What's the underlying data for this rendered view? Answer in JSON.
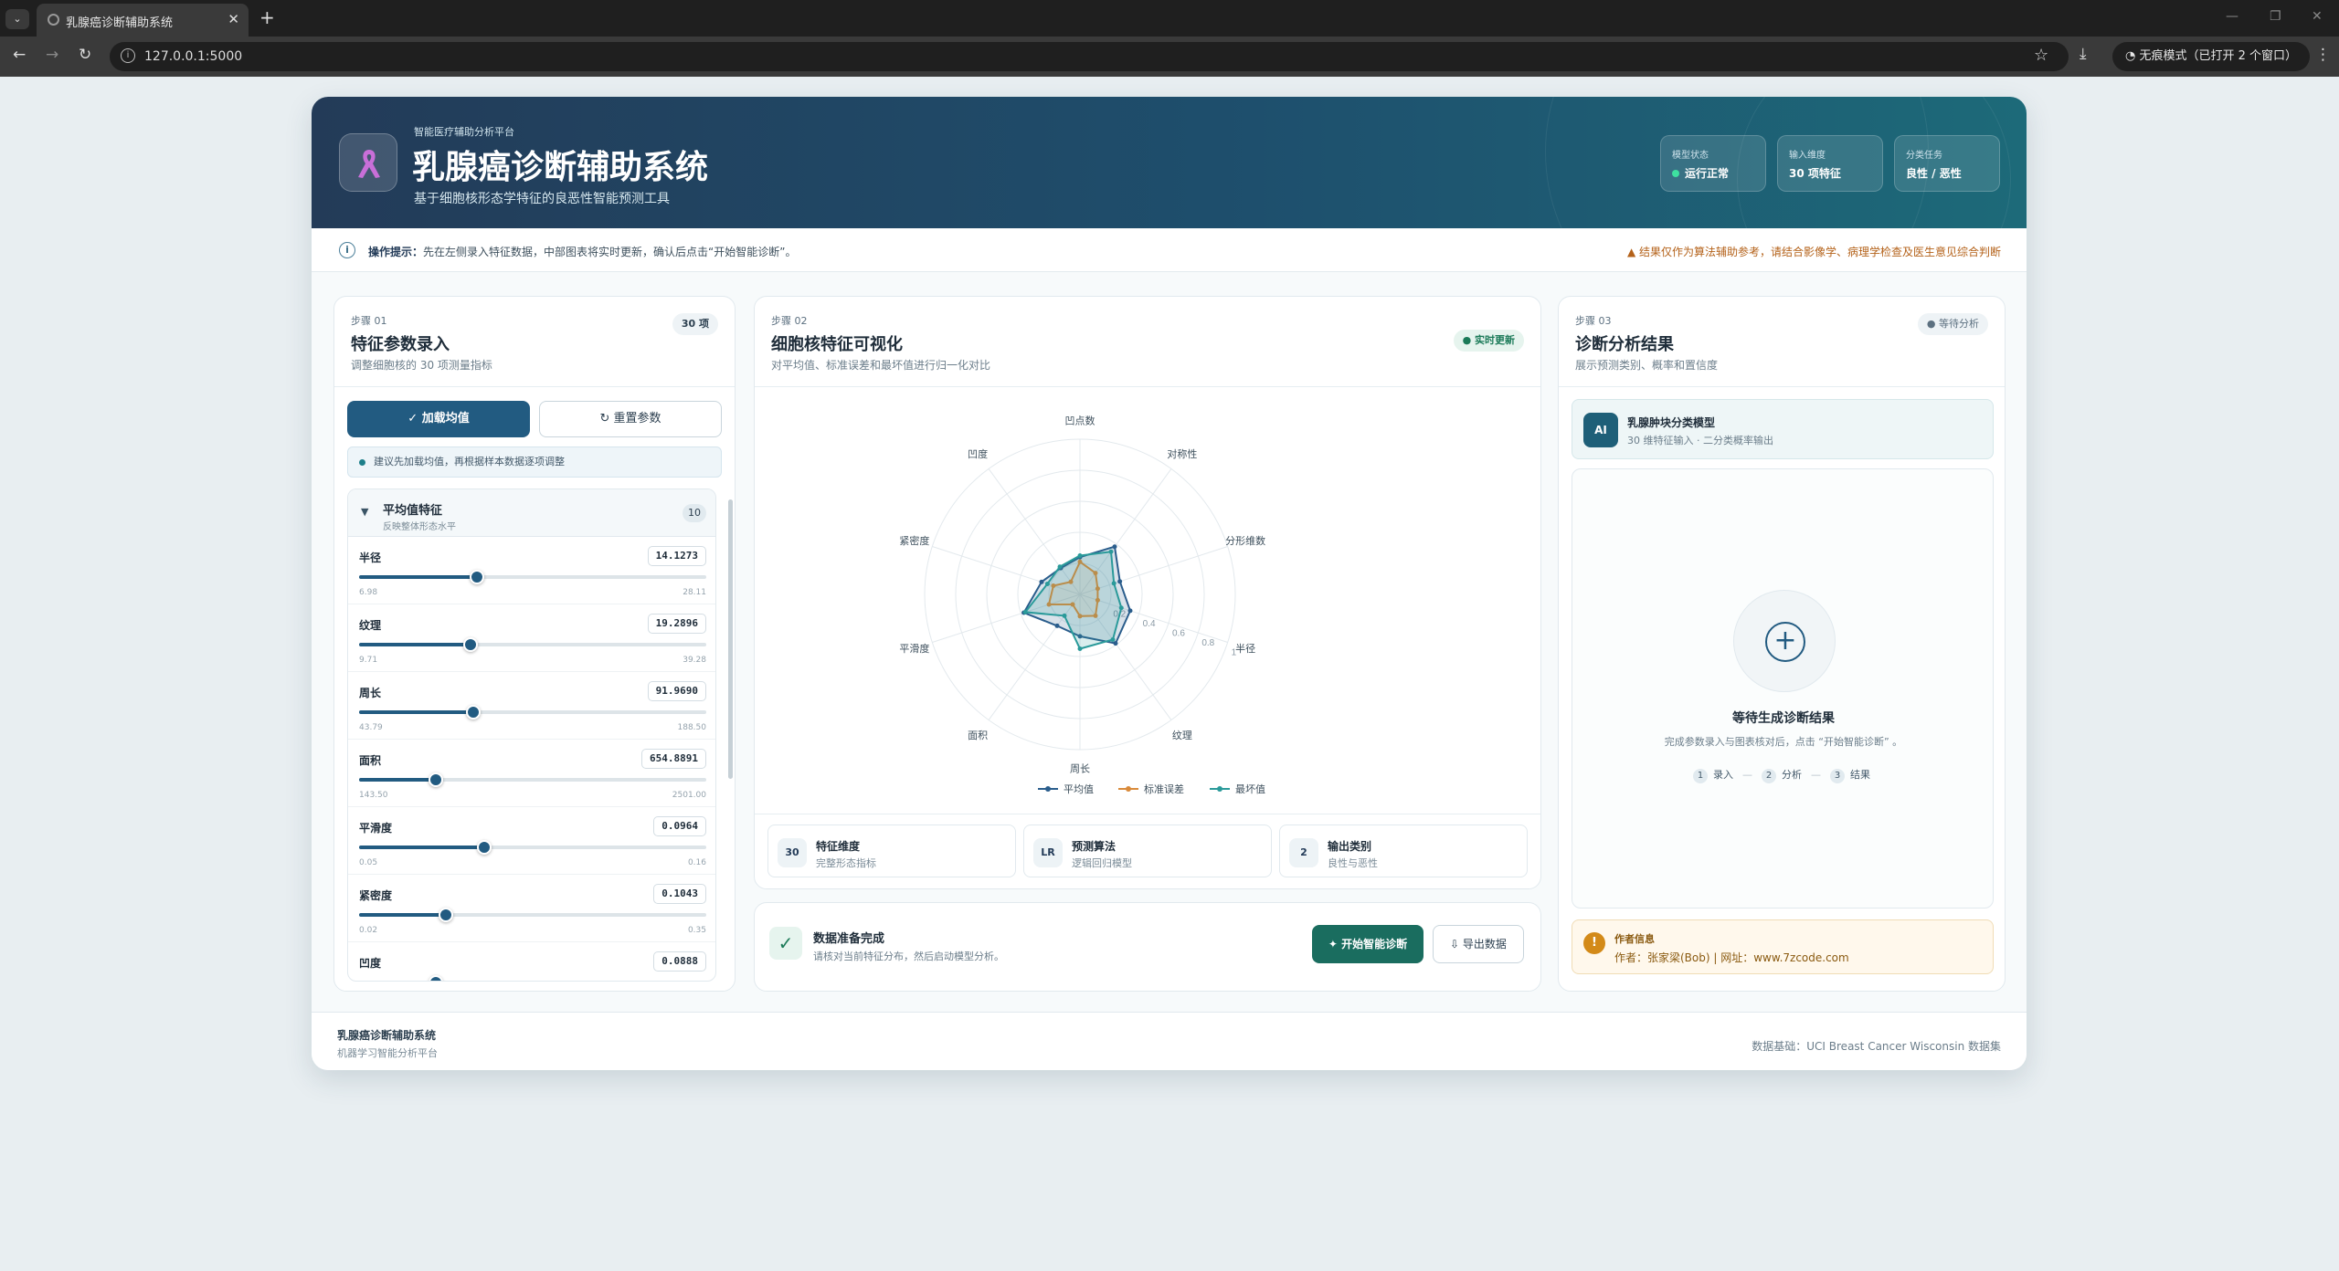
{
  "browser": {
    "tab_title": "乳腺癌诊断辅助系统",
    "url": "127.0.0.1:5000",
    "incognito_label": "无痕模式（已打开 2 个窗口）"
  },
  "header": {
    "kicker": "智能医疗辅助分析平台",
    "title": "乳腺癌诊断辅助系统",
    "subtitle": "基于细胞核形态学特征的良恶性智能预测工具",
    "stats": [
      {
        "label": "模型状态",
        "value": "运行正常"
      },
      {
        "label": "输入维度",
        "value": "30 项特征"
      },
      {
        "label": "分类任务",
        "value": "良性 / 恶性"
      }
    ]
  },
  "tips": {
    "prefix": "操作提示：",
    "text": "先在左侧录入特征数据，中部图表将实时更新，确认后点击“开始智能诊断”。",
    "warning": "结果仅作为算法辅助参考，请结合影像学、病理学检查及医生意见综合判断"
  },
  "left_panel": {
    "step": "步骤 01",
    "title": "特征参数录入",
    "subtitle": "调整细胞核的 30 项测量指标",
    "badge": "30 项",
    "load_button": "加载均值",
    "reset_button": "重置参数",
    "hint": "建议先加载均值，再根据样本数据逐项调整",
    "group": {
      "name": "平均值特征",
      "subtitle": "反映整体形态水平",
      "count": "10"
    },
    "features": [
      {
        "label": "半径",
        "value": "14.1273",
        "min": "6.98",
        "max": "28.11",
        "fraction": 0.34
      },
      {
        "label": "纹理",
        "value": "19.2896",
        "min": "9.71",
        "max": "39.28",
        "fraction": 0.32
      },
      {
        "label": "周长",
        "value": "91.9690",
        "min": "43.79",
        "max": "188.50",
        "fraction": 0.33
      },
      {
        "label": "面积",
        "value": "654.8891",
        "min": "143.50",
        "max": "2501.00",
        "fraction": 0.22
      },
      {
        "label": "平滑度",
        "value": "0.0964",
        "min": "0.05",
        "max": "0.16",
        "fraction": 0.36
      },
      {
        "label": "紧密度",
        "value": "0.1043",
        "min": "0.02",
        "max": "0.35",
        "fraction": 0.25
      },
      {
        "label": "凹度",
        "value": "0.0888",
        "min": "",
        "max": "",
        "fraction": 0.22
      }
    ]
  },
  "middle_panel": {
    "step": "步骤 02",
    "title": "细胞核特征可视化",
    "subtitle": "对平均值、标准误差和最坏值进行归一化对比",
    "badge": "实时更新",
    "stats": [
      {
        "icon": "30",
        "title": "特征维度",
        "desc": "完整形态指标"
      },
      {
        "icon": "LR",
        "title": "预测算法",
        "desc": "逻辑回归模型"
      },
      {
        "icon": "2",
        "title": "输出类别",
        "desc": "良性与恶性"
      }
    ],
    "action": {
      "title": "数据准备完成",
      "desc": "请核对当前特征分布，然后启动模型分析。",
      "start_button": "开始智能诊断",
      "export_button": "导出数据"
    }
  },
  "chart_data": {
    "type": "radar",
    "axes": [
      "半径",
      "纹理",
      "周长",
      "面积",
      "平滑度",
      "紧密度",
      "凹度",
      "凹点数",
      "对称性",
      "分形维数"
    ],
    "rlim": [
      0,
      1
    ],
    "ticks": [
      "0.2",
      "0.4",
      "0.6",
      "0.8",
      "1"
    ],
    "series": [
      {
        "name": "平均值",
        "color": "#2a5d8c",
        "values": [
          0.34,
          0.39,
          0.27,
          0.25,
          0.38,
          0.26,
          0.21,
          0.24,
          0.38,
          0.27
        ]
      },
      {
        "name": "标准误差",
        "color": "#d98a3a",
        "values": [
          0.12,
          0.17,
          0.14,
          0.08,
          0.21,
          0.18,
          0.1,
          0.21,
          0.17,
          0.12
        ]
      },
      {
        "name": "最坏值",
        "color": "#2a9a9a",
        "values": [
          0.28,
          0.36,
          0.35,
          0.17,
          0.37,
          0.22,
          0.22,
          0.25,
          0.34,
          0.23
        ]
      }
    ],
    "legend": "bottom"
  },
  "right_panel": {
    "step": "步骤 03",
    "title": "诊断分析结果",
    "subtitle": "展示预测类别、概率和置信度",
    "badge": "等待分析",
    "model_icon": "AI",
    "model_name": "乳腺肿块分类模型",
    "model_desc": "30 维特征输入 · 二分类概率输出",
    "waiting_title": "等待生成诊断结果",
    "waiting_desc": "完成参数录入与图表核对后，点击 “开始智能诊断” 。",
    "flow": [
      "录入",
      "分析",
      "结果"
    ],
    "author_title": "作者信息",
    "author_text": "作者：张家梁(Bob) | 网址：www.7zcode.com"
  },
  "footer": {
    "title": "乳腺癌诊断辅助系统",
    "subtitle": "机器学习智能分析平台",
    "source": "数据基础：UCI Breast Cancer Wisconsin 数据集"
  }
}
